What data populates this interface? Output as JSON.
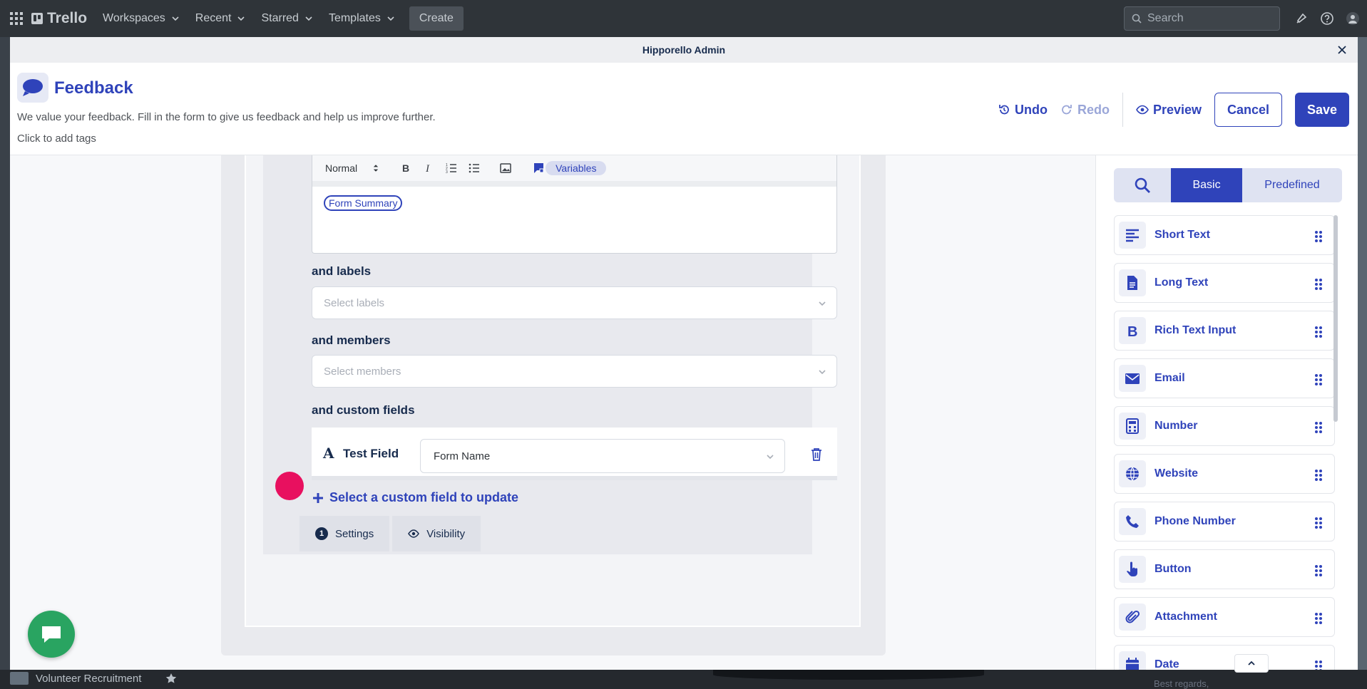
{
  "topbar": {
    "brand": "Trello",
    "nav": [
      "Workspaces",
      "Recent",
      "Starred",
      "Templates"
    ],
    "create_label": "Create",
    "search_placeholder": "Search"
  },
  "board_footer": {
    "board_name": "Volunteer Recruitment",
    "best_regards": "Best regards,"
  },
  "modal": {
    "title": "Hipporello Admin",
    "form_title": "Feedback",
    "form_description": "We value your feedback. Fill in the form to give us feedback and help us improve further.",
    "tags_hint": "Click to add tags",
    "buttons": {
      "undo": "Undo",
      "redo": "Redo",
      "preview": "Preview",
      "cancel": "Cancel",
      "save": "Save"
    }
  },
  "editor": {
    "format_select": "Normal",
    "variables_label": "Variables",
    "chip": "Form Summary"
  },
  "labels_section": {
    "label": "and labels",
    "placeholder": "Select labels"
  },
  "members_section": {
    "label": "and members",
    "placeholder": "Select members"
  },
  "custom_fields": {
    "label": "and custom fields",
    "row": {
      "field_icon": "A",
      "field_name": "Test Field",
      "value": "Form Name"
    },
    "add_label": "Select a custom field to update"
  },
  "bottom_tabs": {
    "settings": "Settings",
    "settings_badge": "1",
    "visibility": "Visibility"
  },
  "sidebar": {
    "tabs": {
      "basic": "Basic",
      "predefined": "Predefined"
    },
    "items": [
      {
        "label": "Short Text",
        "icon": "short-text-icon"
      },
      {
        "label": "Long Text",
        "icon": "document-icon"
      },
      {
        "label": "Rich Text Input",
        "icon": "bold-icon"
      },
      {
        "label": "Email",
        "icon": "envelope-icon"
      },
      {
        "label": "Number",
        "icon": "calculator-icon"
      },
      {
        "label": "Website",
        "icon": "globe-icon"
      },
      {
        "label": "Phone Number",
        "icon": "phone-icon"
      },
      {
        "label": "Button",
        "icon": "hand-pointer-icon"
      },
      {
        "label": "Attachment",
        "icon": "paperclip-icon"
      },
      {
        "label": "Date",
        "icon": "calendar-icon"
      }
    ]
  },
  "colors": {
    "primary": "#2f43ba",
    "accent_dot": "#e8105f",
    "chat": "#29a461"
  }
}
